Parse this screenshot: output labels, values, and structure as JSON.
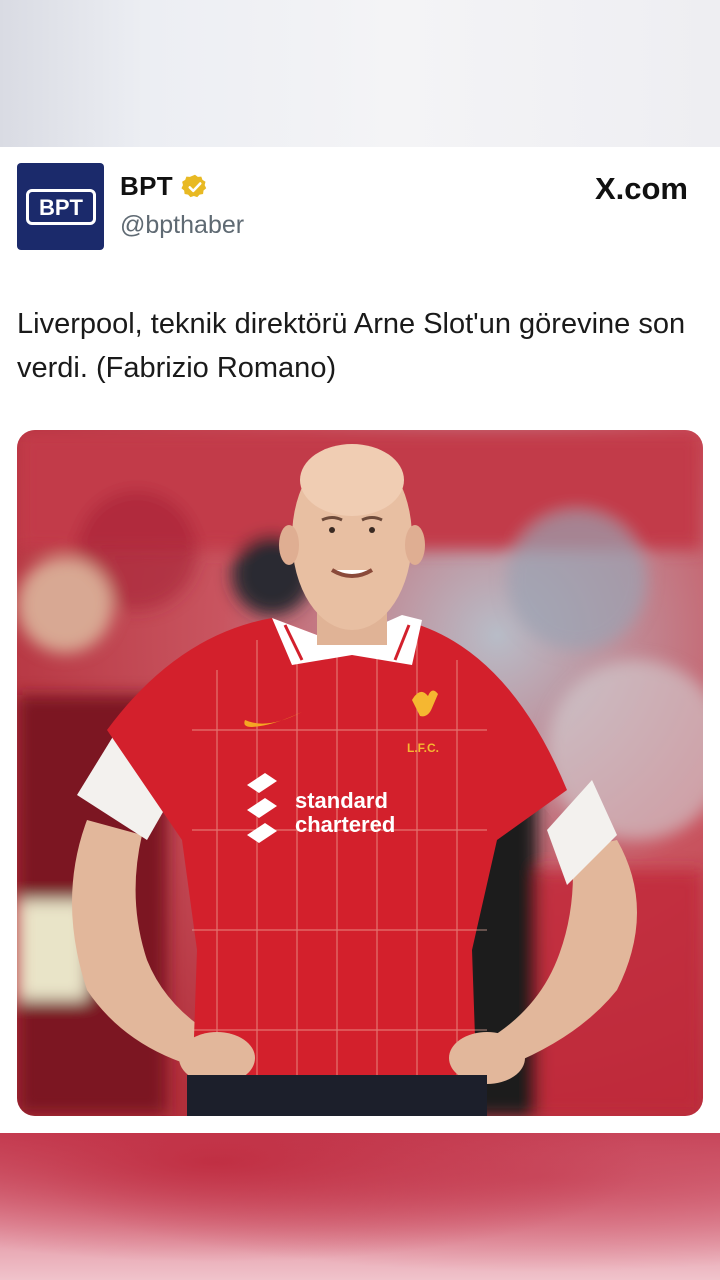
{
  "post": {
    "author_name": "BPT",
    "handle": "@bpthaber",
    "verified": true,
    "avatar_text": "BPT",
    "source_brand": "X.com",
    "text": "Liverpool, teknik direktörü Arne Slot'un görevine son verdi. (Fabrizio Romano)",
    "photo": {
      "jersey_sponsor_line1": "standard",
      "jersey_sponsor_line2": "chartered",
      "crest_text": "L.F.C."
    }
  },
  "colors": {
    "avatar_bg": "#1b2a6b",
    "verified_badge": "#e8b923",
    "jersey_red": "#d3202c"
  },
  "icons": {
    "verified": "verified-badge-icon",
    "x_logo": "x-logo-icon"
  }
}
